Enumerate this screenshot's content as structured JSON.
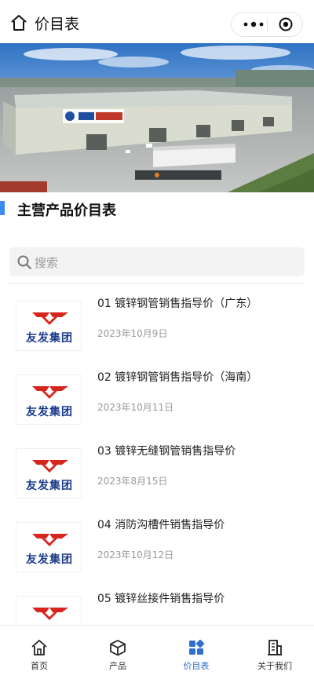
{
  "header": {
    "title": "价目表",
    "more_icon": "more-dots-icon",
    "close_icon": "target-circle-icon"
  },
  "section": {
    "title": "主营产品价目表",
    "accent_color": "#3d8bf0"
  },
  "search": {
    "placeholder": "搜索"
  },
  "products": [
    {
      "title": "01 镀锌钢管销售指导价（广东）",
      "date": "2023年10月9日",
      "logo_text": "友发集团"
    },
    {
      "title": "02 镀锌钢管销售指导价（海南）",
      "date": "2023年10月11日",
      "logo_text": "友发集团"
    },
    {
      "title": "03 镀锌无缝钢管销售指导价",
      "date": "2023年8月15日",
      "logo_text": "友发集团"
    },
    {
      "title": "04 消防沟槽件销售指导价",
      "date": "2023年10月12日",
      "logo_text": "友发集团"
    },
    {
      "title": "05 镀锌丝接件销售指导价",
      "date": "",
      "logo_text": ""
    }
  ],
  "tabbar": {
    "active_color": "#2f6fcf",
    "items": [
      {
        "label": "首页",
        "icon": "home-icon"
      },
      {
        "label": "产品",
        "icon": "cube-icon"
      },
      {
        "label": "价目表",
        "icon": "grid-icon",
        "active": true
      },
      {
        "label": "关于我们",
        "icon": "building-icon"
      }
    ]
  }
}
